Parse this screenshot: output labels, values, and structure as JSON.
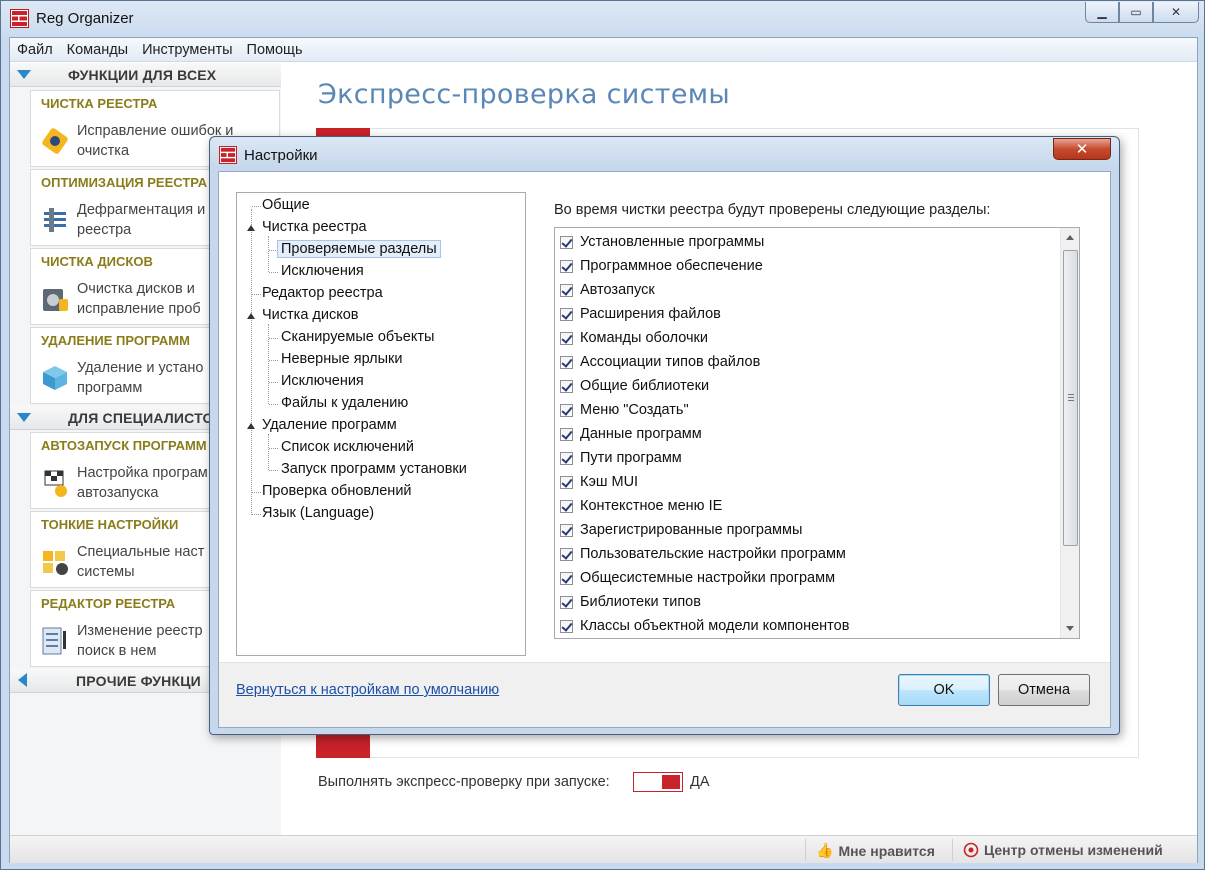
{
  "window": {
    "title": "Reg Organizer"
  },
  "menu": [
    "Файл",
    "Команды",
    "Инструменты",
    "Помощь"
  ],
  "sidebar": {
    "section1": "ФУНКЦИИ ДЛЯ ВСЕХ",
    "section2": "ДЛЯ СПЕЦИАЛИСТО",
    "section3": "ПРОЧИЕ ФУНКЦИ",
    "cards": [
      {
        "category": "ЧИСТКА РЕЕСТРА",
        "desc": "Исправление ошибок и\nочистка",
        "icon": "registry-clean-icon"
      },
      {
        "category": "ОПТИМИЗАЦИЯ РЕЕСТРА",
        "desc": "Дефрагментация и\nреестра",
        "icon": "defrag-icon"
      },
      {
        "category": "ЧИСТКА ДИСКОВ",
        "desc": "Очистка дисков и\nисправление проб",
        "icon": "disk-clean-icon"
      },
      {
        "category": "УДАЛЕНИЕ ПРОГРАММ",
        "desc": "Удаление и устано\nпрограмм",
        "icon": "uninstall-icon"
      },
      {
        "category": "АВТОЗАПУСК ПРОГРАММ",
        "desc": "Настройка програм\nавтозапуска",
        "icon": "autorun-icon"
      },
      {
        "category": "ТОНКИЕ НАСТРОЙКИ",
        "desc": "Специальные наст\nсистемы",
        "icon": "tweaks-icon"
      },
      {
        "category": "РЕДАКТОР РЕЕСТРА",
        "desc": "Изменение реестр\nпоиск в нем",
        "icon": "registry-editor-icon"
      }
    ]
  },
  "main": {
    "title": "Экспресс-проверка системы",
    "express_label": "Выполнять экспресс-проверку при запуске:",
    "express_value": "ДА"
  },
  "status": {
    "like": "Мне нравится",
    "undo_center": "Центр отмены изменений"
  },
  "dialog": {
    "title": "Настройки",
    "tree": [
      {
        "label": "Общие",
        "level": 0
      },
      {
        "label": "Чистка реестра",
        "level": 0,
        "expanded": true
      },
      {
        "label": "Проверяемые разделы",
        "level": 1,
        "selected": true
      },
      {
        "label": "Исключения",
        "level": 1
      },
      {
        "label": "Редактор реестра",
        "level": 0
      },
      {
        "label": "Чистка дисков",
        "level": 0,
        "expanded": true
      },
      {
        "label": "Сканируемые объекты",
        "level": 1
      },
      {
        "label": "Неверные ярлыки",
        "level": 1
      },
      {
        "label": "Исключения",
        "level": 1
      },
      {
        "label": "Файлы к удалению",
        "level": 1
      },
      {
        "label": "Удаление программ",
        "level": 0,
        "expanded": true
      },
      {
        "label": "Список исключений",
        "level": 1
      },
      {
        "label": "Запуск программ установки",
        "level": 1
      },
      {
        "label": "Проверка обновлений",
        "level": 0
      },
      {
        "label": "Язык (Language)",
        "level": 0
      }
    ],
    "list_caption": "Во время чистки реестра будут проверены следующие разделы:",
    "items": [
      "Установленные программы",
      "Программное обеспечение",
      "Автозапуск",
      "Расширения файлов",
      "Команды оболочки",
      "Ассоциации типов файлов",
      "Общие библиотеки",
      "Меню \"Создать\"",
      "Данные программ",
      "Пути программ",
      "Кэш MUI",
      "Контекстное меню IE",
      "Зарегистрированные программы",
      "Пользовательские настройки программ",
      "Общесистемные настройки программ",
      "Библиотеки типов",
      "Классы объектной модели компонентов"
    ],
    "reset_link": "Вернуться к настройкам по умолчанию",
    "ok": "OK",
    "cancel": "Отмена"
  }
}
